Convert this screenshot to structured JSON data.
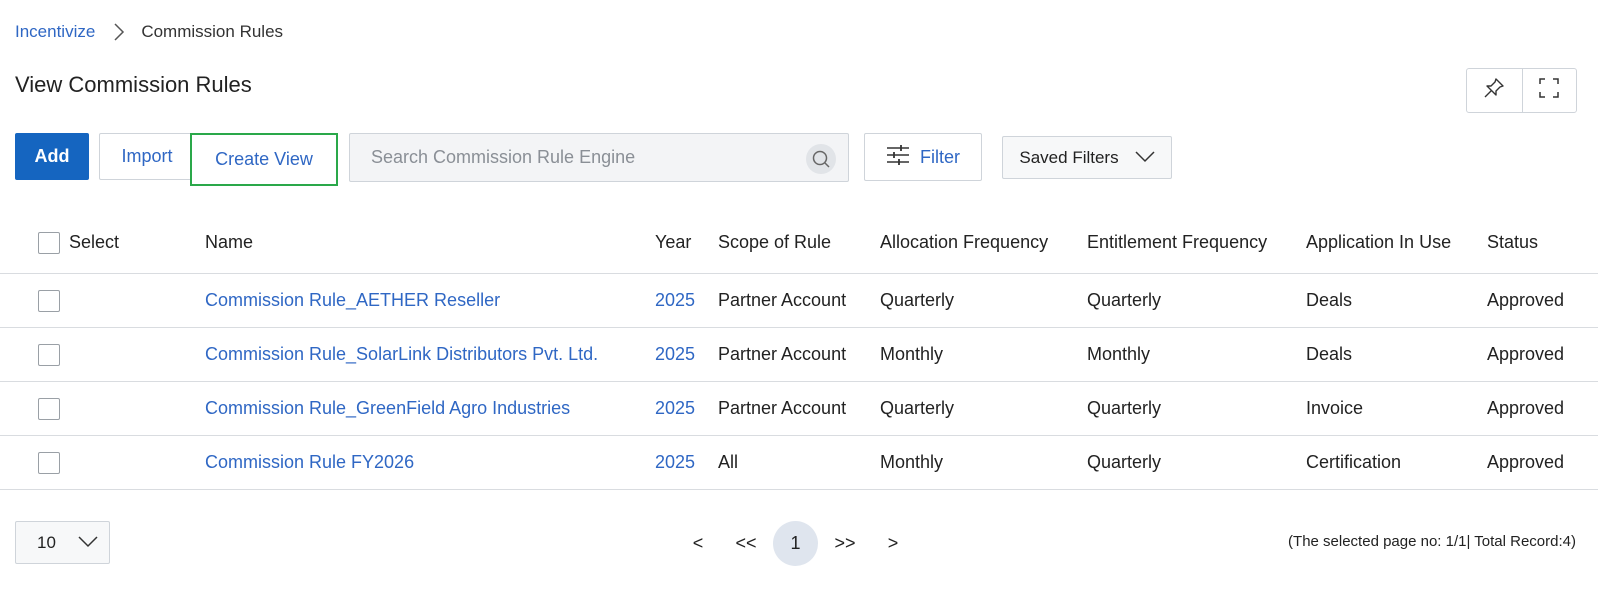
{
  "breadcrumb": {
    "root": "Incentivize",
    "current": "Commission Rules"
  },
  "page": {
    "title": "View Commission Rules"
  },
  "toolbar": {
    "add_label": "Add",
    "import_label": "Import",
    "create_view_label": "Create View",
    "search_placeholder": "Search Commission Rule Engine",
    "filter_label": "Filter",
    "saved_filters_label": "Saved Filters"
  },
  "table": {
    "headers": {
      "select": "Select",
      "name": "Name",
      "year": "Year",
      "scope": "Scope of Rule",
      "allocation": "Allocation Frequency",
      "entitlement": "Entitlement Frequency",
      "application": "Application In Use",
      "status": "Status"
    },
    "rows": [
      {
        "name": "Commission Rule_AETHER Reseller",
        "year": "2025",
        "scope": "Partner Account",
        "allocation": "Quarterly",
        "entitlement": "Quarterly",
        "application": "Deals",
        "status": "Approved"
      },
      {
        "name": "Commission Rule_SolarLink Distributors Pvt. Ltd.",
        "year": "2025",
        "scope": "Partner Account",
        "allocation": "Monthly",
        "entitlement": "Monthly",
        "application": "Deals",
        "status": "Approved"
      },
      {
        "name": "Commission Rule_GreenField Agro Industries",
        "year": "2025",
        "scope": "Partner Account",
        "allocation": "Quarterly",
        "entitlement": "Quarterly",
        "application": "Invoice",
        "status": "Approved"
      },
      {
        "name": "Commission Rule FY2026",
        "year": "2025",
        "scope": "All",
        "allocation": "Monthly",
        "entitlement": "Quarterly",
        "application": "Certification",
        "status": "Approved"
      }
    ]
  },
  "pagination": {
    "page_size": "10",
    "prev": "<",
    "first": "<<",
    "current": "1",
    "last": ">>",
    "next": ">",
    "summary": "(The selected page no: 1/1| Total Record:4)"
  },
  "icons": {
    "breadcrumb_separator": "chevron-right-icon",
    "pin": "pin-icon",
    "fullscreen": "fullscreen-icon",
    "search": "search-icon",
    "filter": "sliders-icon",
    "dropdown": "chevron-down-icon"
  },
  "colors": {
    "primary": "#1565c0",
    "link": "#2f67c4",
    "highlight": "#2aa84a"
  }
}
